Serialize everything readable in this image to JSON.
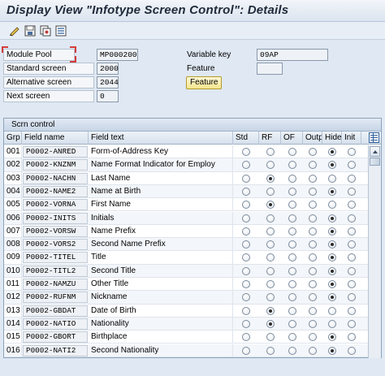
{
  "title": "Display View \"Infotype Screen Control\": Details",
  "toolbar": {
    "buttons": [
      "glasses-edit-icon",
      "save-icon",
      "copy-icon",
      "detail-icon"
    ]
  },
  "form": {
    "module_pool": {
      "label": "Module Pool",
      "value": "MP000200"
    },
    "standard_screen": {
      "label": "Standard screen",
      "value": "2000"
    },
    "alternative_screen": {
      "label": "Alternative screen",
      "value": "2044"
    },
    "next_screen": {
      "label": "Next screen",
      "value": "0"
    },
    "variable_key": {
      "label": "Variable key",
      "value": "09AP"
    },
    "feature": {
      "label": "Feature",
      "value": ""
    },
    "feature_button": "Feature"
  },
  "table": {
    "caption": "Scrn control",
    "columns": [
      "Grp",
      "Field name",
      "Field text",
      "Std",
      "RF",
      "OF",
      "Outp",
      "Hide",
      "Init"
    ],
    "rows": [
      {
        "grp": "001",
        "field": "P0002-ANRED",
        "text": "Form-of-Address Key",
        "sel": 4
      },
      {
        "grp": "002",
        "field": "P0002-KNZNM",
        "text": "Name Format Indicator for Employ",
        "sel": 4
      },
      {
        "grp": "003",
        "field": "P0002-NACHN",
        "text": "Last Name",
        "sel": 1
      },
      {
        "grp": "004",
        "field": "P0002-NAME2",
        "text": "Name at Birth",
        "sel": 4
      },
      {
        "grp": "005",
        "field": "P0002-VORNA",
        "text": "First Name",
        "sel": 1
      },
      {
        "grp": "006",
        "field": "P0002-INITS",
        "text": "Initials",
        "sel": 4
      },
      {
        "grp": "007",
        "field": "P0002-VORSW",
        "text": "Name Prefix",
        "sel": 4
      },
      {
        "grp": "008",
        "field": "P0002-VORS2",
        "text": "Second Name Prefix",
        "sel": 4
      },
      {
        "grp": "009",
        "field": "P0002-TITEL",
        "text": "Title",
        "sel": 4
      },
      {
        "grp": "010",
        "field": "P0002-TITL2",
        "text": "Second Title",
        "sel": 4
      },
      {
        "grp": "011",
        "field": "P0002-NAMZU",
        "text": "Other Title",
        "sel": 4
      },
      {
        "grp": "012",
        "field": "P0002-RUFNM",
        "text": "Nickname",
        "sel": 4
      },
      {
        "grp": "013",
        "field": "P0002-GBDAT",
        "text": "Date of Birth",
        "sel": 1
      },
      {
        "grp": "014",
        "field": "P0002-NATIO",
        "text": "Nationality",
        "sel": 1
      },
      {
        "grp": "015",
        "field": "P0002-GBORT",
        "text": "Birthplace",
        "sel": 4
      },
      {
        "grp": "016",
        "field": "P0002-NATI2",
        "text": "Second Nationality",
        "sel": 4
      }
    ]
  },
  "colors": {
    "background": "#dfe8f3",
    "feature_button": "#f5e58c",
    "table_header": "#d6e0ec"
  }
}
